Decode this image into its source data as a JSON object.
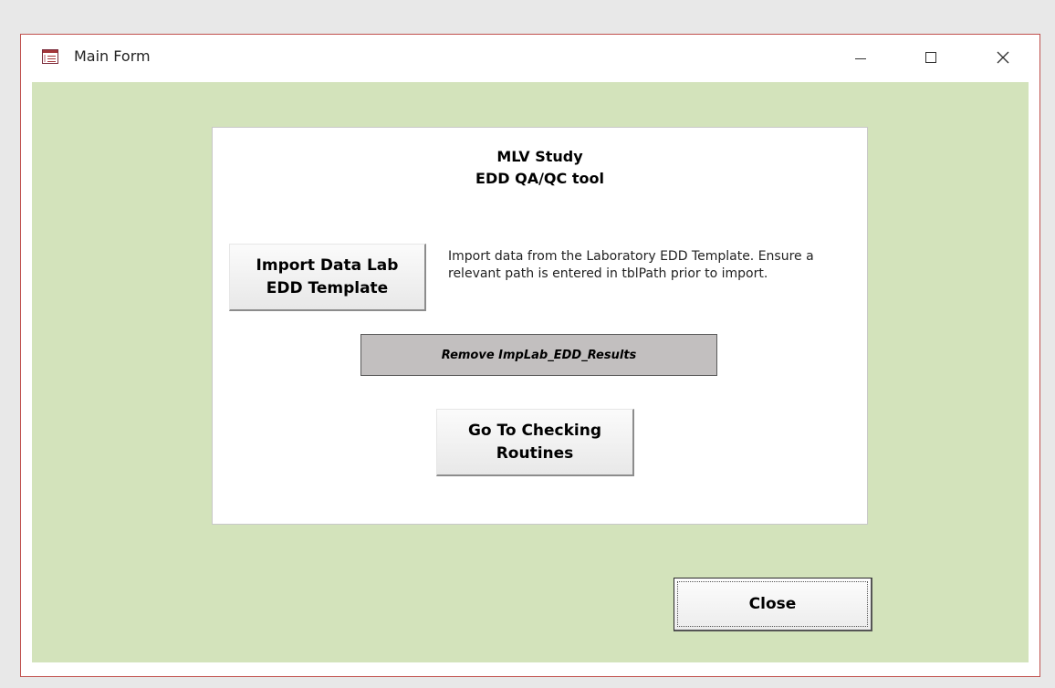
{
  "window": {
    "title": "Main Form",
    "accent_color": "#c0504d",
    "background_color": "#d3e3bb",
    "icon": "access-form-icon",
    "controls": {
      "minimize_icon": "minimize-icon",
      "maximize_icon": "maximize-icon",
      "close_icon": "close-icon"
    }
  },
  "panel": {
    "title_line1": "MLV Study",
    "title_line2": "EDD QA/QC tool",
    "import_button": {
      "line1": "Import Data Lab",
      "line2": "EDD Template"
    },
    "import_description": "Import data from the Laboratory EDD Template. Ensure a relevant path is entered in tblPath prior to import.",
    "remove_button": "Remove ImpLab_EDD_Results",
    "goto_button": {
      "line1": "Go To Checking",
      "line2": "Routines"
    }
  },
  "footer": {
    "close_button": "Close"
  }
}
